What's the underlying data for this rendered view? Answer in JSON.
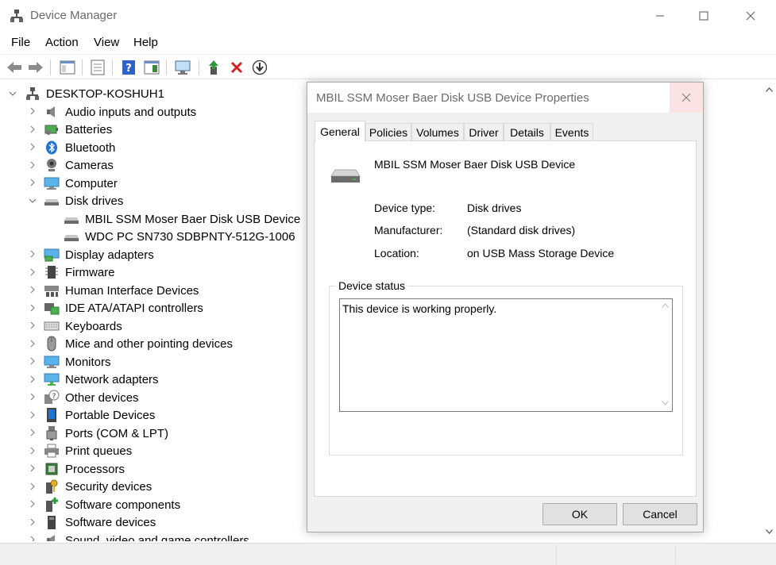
{
  "window": {
    "title": "Device Manager"
  },
  "menu": [
    "File",
    "Action",
    "View",
    "Help"
  ],
  "tree": {
    "root": "DESKTOP-KOSHUH1",
    "categories": [
      {
        "label": "Audio inputs and outputs",
        "icon": "speaker-icon"
      },
      {
        "label": "Batteries",
        "icon": "battery-icon"
      },
      {
        "label": "Bluetooth",
        "icon": "bluetooth-icon"
      },
      {
        "label": "Cameras",
        "icon": "camera-icon"
      },
      {
        "label": "Computer",
        "icon": "computer-icon"
      },
      {
        "label": "Disk drives",
        "icon": "disk-drive-icon",
        "expanded": true,
        "children": [
          "MBIL SSM Moser Baer Disk USB Device",
          "WDC PC SN730 SDBPNTY-512G-1006"
        ]
      },
      {
        "label": "Display adapters",
        "icon": "display-adapter-icon"
      },
      {
        "label": "Firmware",
        "icon": "firmware-icon"
      },
      {
        "label": "Human Interface Devices",
        "icon": "hid-icon"
      },
      {
        "label": "IDE ATA/ATAPI controllers",
        "icon": "ide-controller-icon"
      },
      {
        "label": "Keyboards",
        "icon": "keyboard-icon"
      },
      {
        "label": "Mice and other pointing devices",
        "icon": "mouse-icon"
      },
      {
        "label": "Monitors",
        "icon": "monitor-icon"
      },
      {
        "label": "Network adapters",
        "icon": "network-adapter-icon"
      },
      {
        "label": "Other devices",
        "icon": "other-devices-icon"
      },
      {
        "label": "Portable Devices",
        "icon": "portable-device-icon"
      },
      {
        "label": "Ports (COM & LPT)",
        "icon": "port-icon"
      },
      {
        "label": "Print queues",
        "icon": "printer-icon"
      },
      {
        "label": "Processors",
        "icon": "processor-icon"
      },
      {
        "label": "Security devices",
        "icon": "security-device-icon"
      },
      {
        "label": "Software components",
        "icon": "software-component-icon"
      },
      {
        "label": "Software devices",
        "icon": "software-device-icon"
      },
      {
        "label": "Sound, video and game controllers",
        "icon": "sound-controller-icon"
      }
    ]
  },
  "dialog": {
    "title": "MBIL SSM Moser Baer Disk USB Device Properties",
    "tabs": [
      "General",
      "Policies",
      "Volumes",
      "Driver",
      "Details",
      "Events"
    ],
    "active_tab": "General",
    "device_name": "MBIL SSM Moser Baer Disk USB Device",
    "fields": {
      "type_label": "Device type:",
      "type_value": "Disk drives",
      "manufacturer_label": "Manufacturer:",
      "manufacturer_value": "(Standard disk drives)",
      "location_label": "Location:",
      "location_value": "on USB Mass Storage Device"
    },
    "status_legend": "Device status",
    "status_text": "This device is working properly.",
    "ok_label": "OK",
    "cancel_label": "Cancel"
  },
  "colors": {
    "accent_blue": "#1e73d6",
    "close_hover": "#fbe3e4",
    "remove_red": "#d42020",
    "update_green": "#2e9b3a"
  }
}
